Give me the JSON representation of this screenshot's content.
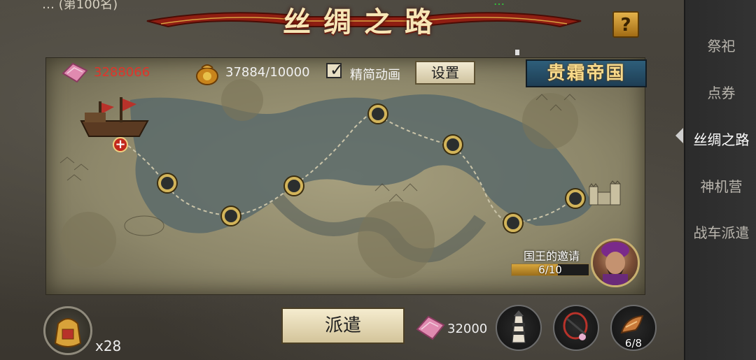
{
  "status": {
    "top_left": "…  (第100名)",
    "top_right": "…"
  },
  "title": "丝绸之路",
  "help_label": "?",
  "sidebar": {
    "items": [
      {
        "label": "祭祀",
        "active": false
      },
      {
        "label": "点券",
        "active": false
      },
      {
        "label": "丝绸之路",
        "active": true
      },
      {
        "label": "神机营",
        "active": false
      },
      {
        "label": "战车派遣",
        "active": false
      }
    ]
  },
  "header": {
    "gem_icon": "pink-silk-scroll-icon",
    "gem_value": "3288066",
    "gem_color": "#e0342a",
    "coin_icon": "gold-coin-bag-icon",
    "coin_value": "37884/10000",
    "simple_anim_checked": true,
    "simple_anim_label": "精简动画",
    "settings_label": "设置",
    "vip_label": "贵霜帝国"
  },
  "route": {
    "ship_icon": "merchant-ship-icon",
    "plus_label": "+",
    "castle_icon": "castle-icon",
    "node_count": 8
  },
  "invite": {
    "title": "国王的邀请",
    "progress_text": "6/10",
    "progress": 0.6,
    "portrait_icon": "king-portrait-icon"
  },
  "bottom": {
    "treasure_icon": "treasure-bag-icon",
    "treasure_count": "x28",
    "dispatch_label": "派遣",
    "cost_icon": "pink-silk-scroll-icon",
    "cost_value": "32000",
    "slots": [
      {
        "icon": "lighthouse-icon",
        "count": ""
      },
      {
        "icon": "compass-necklace-icon",
        "count": ""
      },
      {
        "icon": "conch-horn-icon",
        "count": "6/8"
      }
    ]
  }
}
